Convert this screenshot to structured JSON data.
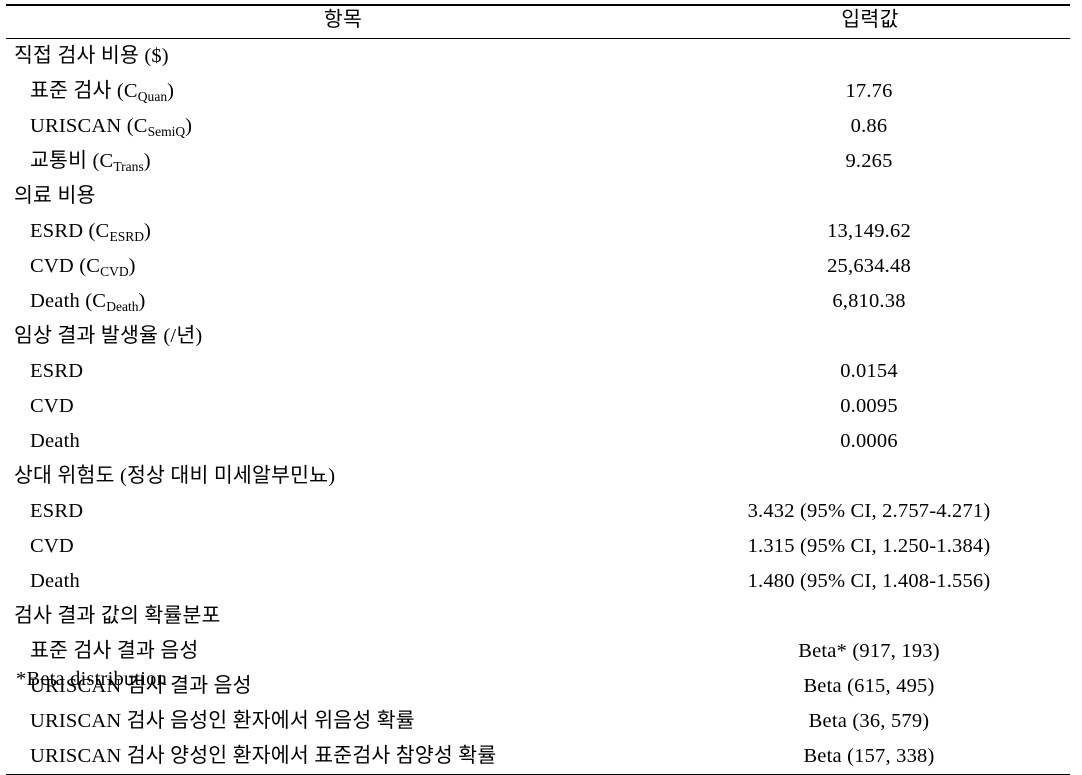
{
  "table": {
    "headers": {
      "item": "항목",
      "value": "입력값"
    },
    "rows": [
      {
        "label": "직접 검사 비용 ($)",
        "value": "",
        "indent": false
      },
      {
        "label": "표준 검사 (C",
        "sub": "Quan",
        "label_tail": ")",
        "value": "17.76",
        "indent": true
      },
      {
        "label": "URISCAN (C",
        "sub": "SemiQ",
        "label_tail": ")",
        "value": "0.86",
        "indent": true
      },
      {
        "label": "교통비 (C",
        "sub": "Trans",
        "label_tail": ")",
        "value": "9.265",
        "indent": true
      },
      {
        "label": "의료 비용",
        "value": "",
        "indent": false
      },
      {
        "label": "ESRD (C",
        "sub": "ESRD",
        "label_tail": ")",
        "value": "13,149.62",
        "indent": true
      },
      {
        "label": "CVD (C",
        "sub": "CVD",
        "label_tail": ")",
        "value": "25,634.48",
        "indent": true
      },
      {
        "label": "Death (C",
        "sub": "Death",
        "label_tail": ")",
        "value": "6,810.38",
        "indent": true
      },
      {
        "label": "임상 결과 발생율 (/년)",
        "value": "",
        "indent": false
      },
      {
        "label": "ESRD",
        "value": "0.0154",
        "indent": true
      },
      {
        "label": "CVD",
        "value": "0.0095",
        "indent": true
      },
      {
        "label": "Death",
        "value": "0.0006",
        "indent": true
      },
      {
        "label": "상대 위험도 (정상 대비 미세알부민뇨)",
        "value": "",
        "indent": false
      },
      {
        "label": "ESRD",
        "value": "3.432 (95% CI, 2.757-4.271)",
        "indent": true
      },
      {
        "label": "CVD",
        "value": "1.315 (95% CI, 1.250-1.384)",
        "indent": true
      },
      {
        "label": "Death",
        "value": "1.480 (95% CI, 1.408-1.556)",
        "indent": true
      },
      {
        "label": "검사 결과 값의 확률분포",
        "value": "",
        "indent": false
      },
      {
        "label": "표준 검사 결과 음성",
        "value": "Beta* (917, 193)",
        "indent": true
      },
      {
        "label": "URISCAN 검사 결과 음성",
        "value": "Beta (615, 495)",
        "indent": true
      },
      {
        "label": "URISCAN 검사 음성인 환자에서 위음성 확률",
        "value": "Beta (36, 579)",
        "indent": true
      },
      {
        "label": "URISCAN 검사 양성인 환자에서 표준검사 참양성 확률",
        "value": "Beta (157, 338)",
        "indent": true
      }
    ]
  },
  "footnote": "*Beta distribution"
}
